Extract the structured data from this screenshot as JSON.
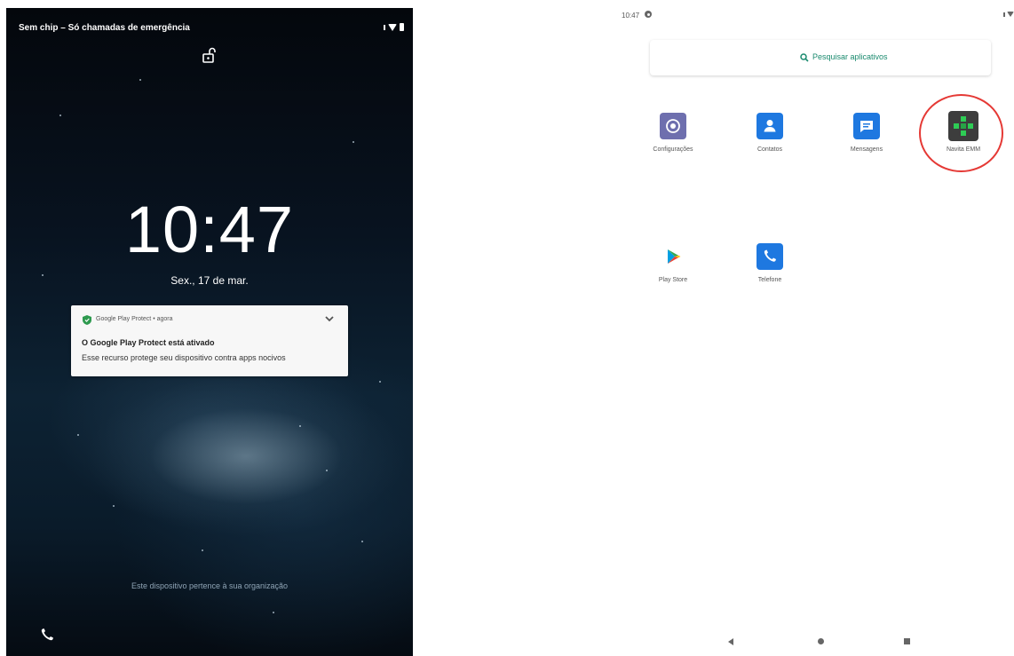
{
  "lock_screen": {
    "carrier_status": "Sem chip – Só chamadas de emergência",
    "time": "10:47",
    "date": "Sex., 17 de mar.",
    "notification": {
      "app_line": "Google Play Protect • agora",
      "title": "O Google Play Protect está ativado",
      "body": "Esse recurso protege seu dispositivo contra apps nocivos"
    },
    "owner_text": "Este dispositivo pertence à sua organização"
  },
  "app_drawer": {
    "status_time": "10:47",
    "search_placeholder": "Pesquisar aplicativos",
    "apps": [
      {
        "label": "Configurações",
        "icon": "settings-icon",
        "color": "#6e6fae"
      },
      {
        "label": "Contatos",
        "icon": "contacts-icon",
        "color": "#1e78e0"
      },
      {
        "label": "Mensagens",
        "icon": "messages-icon",
        "color": "#1e78e0"
      },
      {
        "label": "Navita EMM",
        "icon": "navita-emm-icon",
        "color": "#3d3d3d"
      },
      {
        "label": "Play Store",
        "icon": "play-store-icon",
        "color": "#ffffff"
      },
      {
        "label": "Telefone",
        "icon": "phone-icon",
        "color": "#1e78e0"
      }
    ],
    "highlight_color": "#e53935"
  }
}
